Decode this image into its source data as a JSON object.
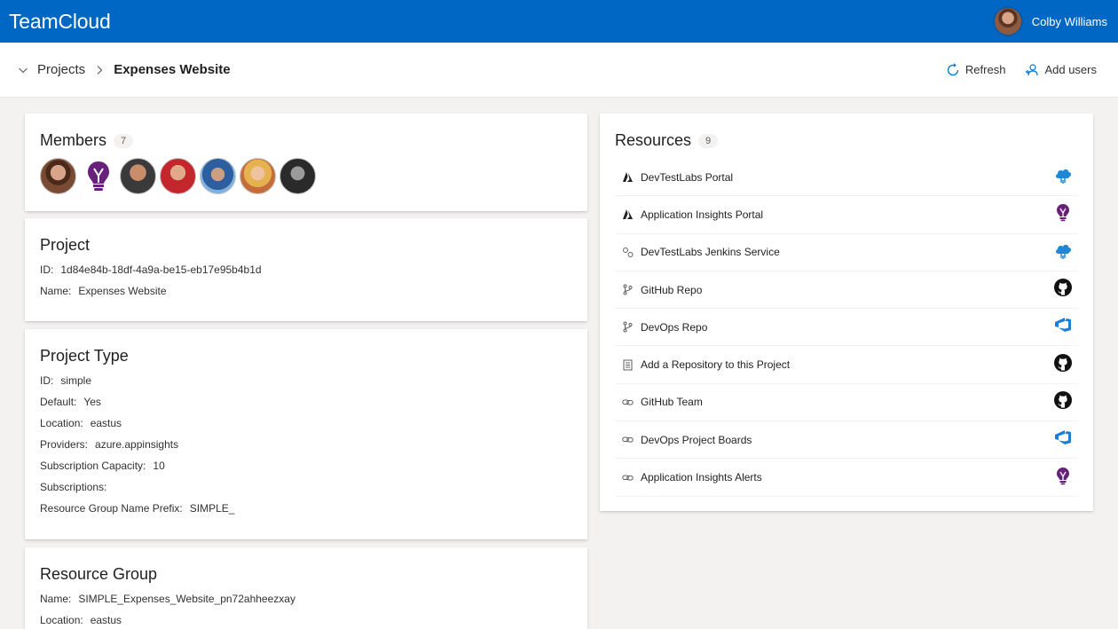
{
  "app": {
    "title": "TeamCloud"
  },
  "user": {
    "name": "Colby Williams"
  },
  "breadcrumb": {
    "root": "Projects",
    "current": "Expenses Website"
  },
  "commands": {
    "refresh": "Refresh",
    "add_users": "Add users"
  },
  "members": {
    "title": "Members",
    "count": "7",
    "avatars": [
      "avatar-1",
      "lightbulb-icon",
      "avatar-3",
      "avatar-4",
      "avatar-5",
      "avatar-6",
      "avatar-7"
    ]
  },
  "project": {
    "title": "Project",
    "fields": [
      {
        "key": "ID:",
        "value": "1d84e84b-18df-4a9a-be15-eb17e95b4b1d"
      },
      {
        "key": "Name:",
        "value": "Expenses Website"
      }
    ]
  },
  "project_type": {
    "title": "Project Type",
    "fields": [
      {
        "key": "ID:",
        "value": "simple"
      },
      {
        "key": "Default:",
        "value": "Yes"
      },
      {
        "key": "Location:",
        "value": "eastus"
      },
      {
        "key": "Providers:",
        "value": "azure.appinsights"
      },
      {
        "key": "Subscription Capacity:",
        "value": "10"
      },
      {
        "key": "Subscriptions:",
        "value": ""
      },
      {
        "key": "Resource Group Name Prefix:",
        "value": "SIMPLE_"
      }
    ]
  },
  "resource_group": {
    "title": "Resource Group",
    "fields": [
      {
        "key": "Name:",
        "value": "SIMPLE_Expenses_Website_pn72ahheezxay"
      },
      {
        "key": "Location:",
        "value": "eastus"
      }
    ]
  },
  "resources": {
    "title": "Resources",
    "count": "9",
    "items": [
      {
        "label": "DevTestLabs Portal",
        "icon": "azure-icon",
        "provider": "devtestlabs-icon"
      },
      {
        "label": "Application Insights Portal",
        "icon": "azure-icon",
        "provider": "appinsights-icon"
      },
      {
        "label": "DevTestLabs Jenkins Service",
        "icon": "service-icon",
        "provider": "devtestlabs-icon"
      },
      {
        "label": "GitHub Repo",
        "icon": "branch-icon",
        "provider": "github-icon"
      },
      {
        "label": "DevOps Repo",
        "icon": "branch-icon",
        "provider": "azure-devops-icon"
      },
      {
        "label": "Add a Repository to this Project",
        "icon": "document-icon",
        "provider": "github-icon"
      },
      {
        "label": "GitHub Team",
        "icon": "link-icon",
        "provider": "github-icon"
      },
      {
        "label": "DevOps Project Boards",
        "icon": "link-icon",
        "provider": "azure-devops-icon"
      },
      {
        "label": "Application Insights Alerts",
        "icon": "link-icon",
        "provider": "appinsights-icon"
      }
    ]
  },
  "colors": {
    "brand": "#0067c5",
    "devtestlabs": "#1e88d4",
    "appinsights": "#68217a",
    "github": "#111111",
    "devops": "#1e7fd6"
  }
}
